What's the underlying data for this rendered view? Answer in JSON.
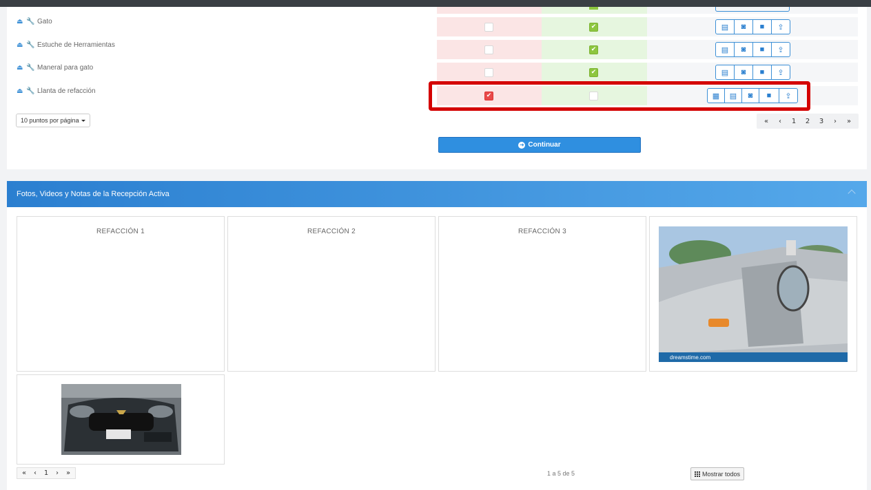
{
  "items": [
    {
      "label": "Gato",
      "red_checked": false,
      "green_checked": true
    },
    {
      "label": "Estuche de Herramientas",
      "red_checked": false,
      "green_checked": true
    },
    {
      "label": "Maneral para gato",
      "red_checked": false,
      "green_checked": true
    },
    {
      "label": "Llanta de refacción",
      "red_checked": true,
      "green_checked": false
    }
  ],
  "icons": {
    "eject": "eject-icon",
    "wrench": "wrench-icon",
    "grid": "grid-icon",
    "document": "document-icon",
    "camera": "camera-icon",
    "video": "video-icon",
    "upload": "upload-icon"
  },
  "per_page": {
    "label": "10 puntos por página"
  },
  "pager_top": {
    "first": "«",
    "prev": "‹",
    "pages": [
      "1",
      "2",
      "3"
    ],
    "next": "›",
    "last": "»"
  },
  "continue_button": {
    "label": "Continuar"
  },
  "media_section": {
    "title": "Fotos, Videos y Notas de la Recepción Activa",
    "tiles": [
      {
        "title": "REFACCIÓN 1"
      },
      {
        "title": "REFACCIÓN 2"
      },
      {
        "title": "REFACCIÓN 3"
      }
    ],
    "photo_watermark": "dreamstime.com"
  },
  "pager_bottom": {
    "first": "«",
    "prev": "‹",
    "page": "1",
    "next": "›",
    "last": "»"
  },
  "count_text": "1 a 5 de 5",
  "show_all": {
    "label": "Mostrar todos"
  },
  "colors": {
    "accent": "#2f8fe0",
    "highlight": "#d40000",
    "ok_green": "#8dc63f",
    "bad_red": "#e84a4a"
  }
}
